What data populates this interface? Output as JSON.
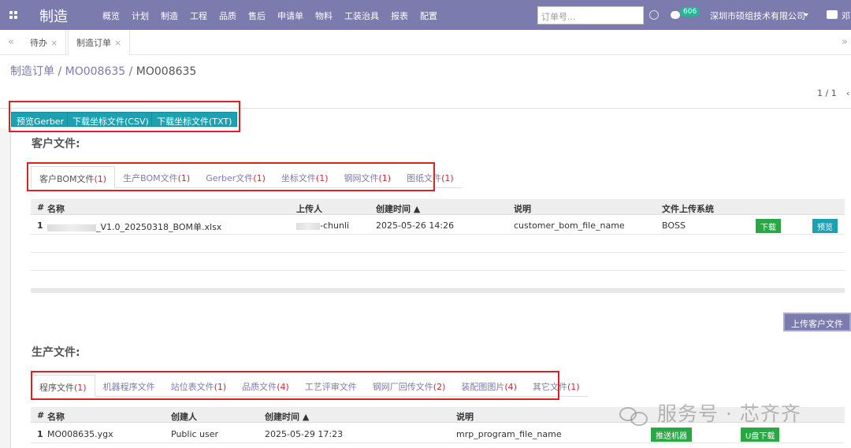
{
  "topbar": {
    "brand": "制造",
    "menu": [
      "概览",
      "计划",
      "制造",
      "工程",
      "品质",
      "售后",
      "申请单",
      "物料",
      "工装治具",
      "报表",
      "配置"
    ],
    "search_placeholder": "订单号...",
    "message_count": "606",
    "company": "深圳市硕组技术有限公司",
    "user_trunc": "邓"
  },
  "window_tabs": [
    {
      "label": "待办",
      "close": "×"
    },
    {
      "label": "制造订单",
      "close": "×"
    }
  ],
  "nav_icons": {
    "collapse_left": "«",
    "collapse_right": "»"
  },
  "breadcrumb": {
    "part1": "制造订单",
    "sep": " / ",
    "part2": "MO008635",
    "part3": "MO008635"
  },
  "pager": {
    "text": "1 / 1"
  },
  "toolbar": {
    "preview_gerber": "预览Gerber",
    "download_csv": "下载坐标文件(CSV)",
    "download_txt": "下载坐标文件(TXT)"
  },
  "customer_section": {
    "title": "客户文件:",
    "tabs": [
      {
        "label": "客户BOM文件",
        "count": "(1)"
      },
      {
        "label": "生产BOM文件",
        "count": "(1)"
      },
      {
        "label": "Gerber文件",
        "count": "(1)"
      },
      {
        "label": "坐标文件",
        "count": "(1)"
      },
      {
        "label": "钢网文件",
        "count": "(1)"
      },
      {
        "label": "图纸文件",
        "count": "(1)"
      }
    ],
    "headers": {
      "num": "#",
      "name": "名称",
      "uploader": "上传人",
      "created": "创建时间 ▲",
      "desc": "说明",
      "system": "文件上传系统"
    },
    "rows": [
      {
        "num": "1",
        "name": "_V1.0_20250318_BOM单.xlsx",
        "uploader": "-chunli",
        "created": "2025-05-26 14:26",
        "desc": "customer_bom_file_name",
        "system": "BOSS",
        "download": "下载",
        "preview": "预览"
      }
    ],
    "upload_button": "上传客户文件"
  },
  "production_section": {
    "title": "生产文件:",
    "tabs": [
      {
        "label": "程序文件",
        "count": "(1)"
      },
      {
        "label": "机器程序文件",
        "count": ""
      },
      {
        "label": "站位表文件",
        "count": "(1)"
      },
      {
        "label": "品质文件",
        "count": "(4)"
      },
      {
        "label": "工艺评审文件",
        "count": ""
      },
      {
        "label": "钢网厂回传文件",
        "count": "(2)"
      },
      {
        "label": "装配图图片",
        "count": "(4)"
      },
      {
        "label": "其它文件",
        "count": "(1)"
      }
    ],
    "headers": {
      "num": "#",
      "name": "名称",
      "creator": "创建人",
      "created": "创建时间 ▲",
      "desc": "说明"
    },
    "rows": [
      {
        "num": "1",
        "name": "MO008635.ygx",
        "creator": "Public user",
        "created": "2025-05-29 17:23",
        "desc": "mrp_program_file_name",
        "push": "推送机器",
        "usb": "U盘下载"
      }
    ]
  },
  "watermark": "服务号 · 芯齐齐",
  "colors": {
    "topbar": "#7c7bad",
    "teal_button": "#1ba1b2",
    "green_button": "#28a745",
    "highlight_box": "#e02020",
    "count_red": "#d9232d"
  }
}
